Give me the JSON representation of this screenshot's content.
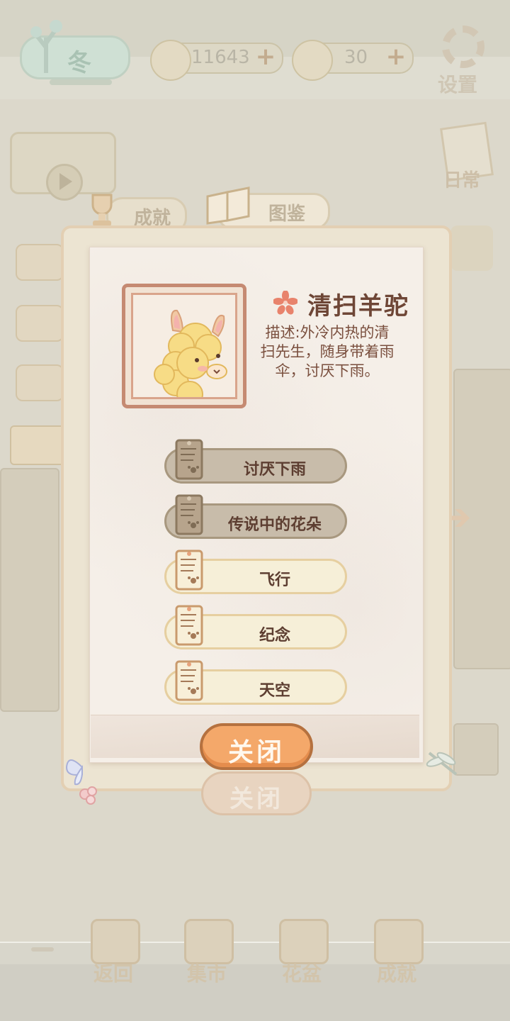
{
  "top_bar": {
    "season_label": "冬",
    "currency_1": {
      "value": "11643",
      "plus": "+",
      "icon": "fish-bone-icon"
    },
    "currency_2": {
      "value": "30",
      "plus": "+",
      "icon": "cheese-icon"
    },
    "settings_label": "设置"
  },
  "side": {
    "daily_label": "日常"
  },
  "tabs": {
    "achievements": "成就",
    "encyclopedia": "图鉴"
  },
  "character": {
    "name": "清扫羊驼",
    "description": "描述:外冷内热的清扫先生，随身带着雨伞，讨厌下雨。"
  },
  "entries": [
    {
      "label": "讨厌下雨",
      "state": "locked"
    },
    {
      "label": "传说中的花朵",
      "state": "locked"
    },
    {
      "label": "飞行",
      "state": "unlocked"
    },
    {
      "label": "纪念",
      "state": "unlocked"
    },
    {
      "label": "天空",
      "state": "unlocked"
    }
  ],
  "buttons": {
    "close": "关闭",
    "close_ghost": "关闭"
  },
  "bottom_nav": [
    {
      "label": "返回"
    },
    {
      "label": "集市"
    },
    {
      "label": "花盆"
    },
    {
      "label": "成就"
    }
  ],
  "colors": {
    "accent_orange": "#f4a86a",
    "text_brown": "#6e4636",
    "locked_entry": "#c8bcaa",
    "unlocked_entry": "#f6efd8"
  }
}
